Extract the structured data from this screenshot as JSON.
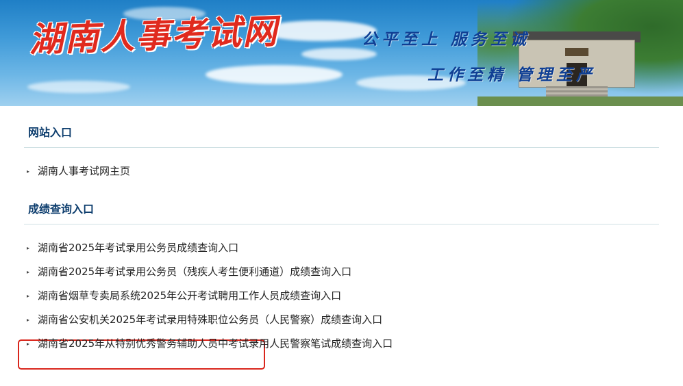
{
  "banner": {
    "site_name": "湖南人事考试网",
    "slogan_line1": "公平至上 服务至诚",
    "slogan_line2": "工作至精 管理至严"
  },
  "sections": [
    {
      "title": "网站入口",
      "items": [
        {
          "label": "湖南人事考试网主页"
        }
      ]
    },
    {
      "title": "成绩查询入口",
      "items": [
        {
          "label": "湖南省2025年考试录用公务员成绩查询入口",
          "highlighted": true
        },
        {
          "label": "湖南省2025年考试录用公务员（残疾人考生便利通道）成绩查询入口"
        },
        {
          "label": "湖南省烟草专卖局系统2025年公开考试聘用工作人员成绩查询入口"
        },
        {
          "label": "湖南省公安机关2025年考试录用特殊职位公务员（人民警察）成绩查询入口"
        },
        {
          "label": "湖南省2025年从特别优秀警务辅助人员中考试录用人民警察笔试成绩查询入口"
        }
      ]
    }
  ],
  "colors": {
    "section_title": "#0e3e6e",
    "highlight_border": "#d9261c",
    "logo_red": "#e02a1e",
    "slogan_blue": "#0f3f94"
  }
}
